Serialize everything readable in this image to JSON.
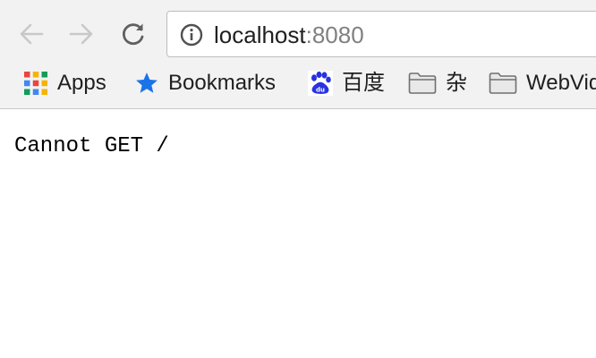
{
  "browser": {
    "nav": {
      "back_icon": "arrow-left-icon",
      "forward_icon": "arrow-right-icon",
      "reload_icon": "reload-icon"
    },
    "address_bar": {
      "icon": "info-icon",
      "host": "localhost",
      "port": ":8080"
    },
    "bookmarks": [
      {
        "label": "Apps",
        "icon": "apps-grid-icon"
      },
      {
        "label": "Bookmarks",
        "icon": "star-icon"
      },
      {
        "label": "百度",
        "icon": "baidu-paw-icon"
      },
      {
        "label": "杂",
        "icon": "folder-icon"
      },
      {
        "label": "WebVid",
        "icon": "folder-icon"
      }
    ]
  },
  "page": {
    "message": "Cannot GET /"
  },
  "colors": {
    "chrome_bg": "#f2f2f2",
    "star_blue": "#1a73e8",
    "baidu_blue": "#2932e1",
    "nav_disabled": "#c8c8c8",
    "nav_enabled": "#606060"
  }
}
